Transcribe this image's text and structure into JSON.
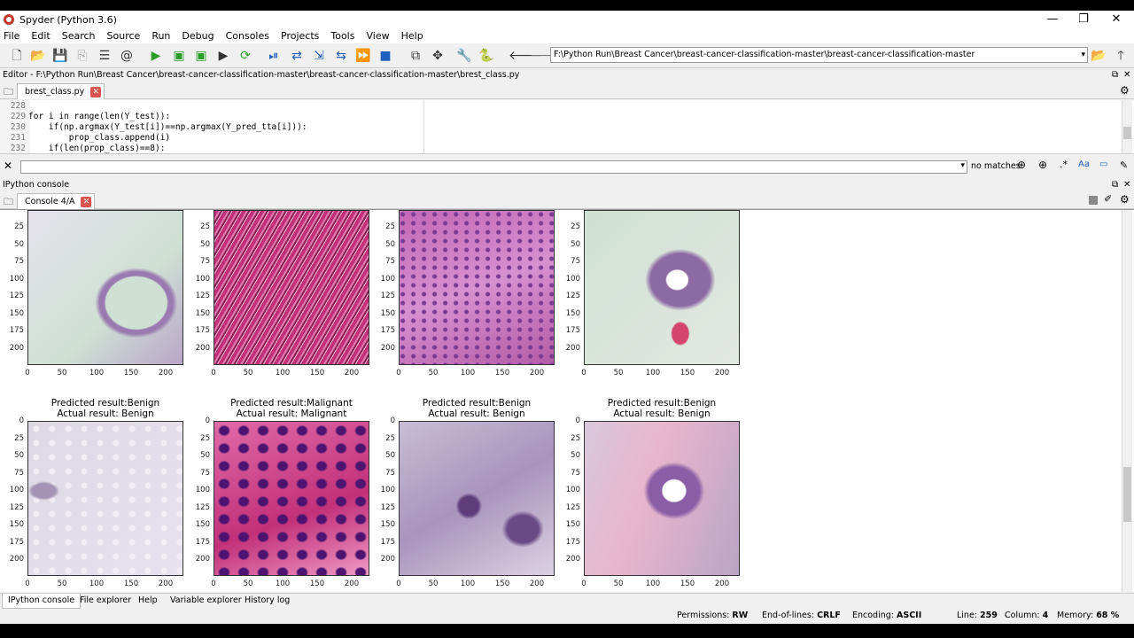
{
  "window": {
    "title": "Spyder (Python 3.6)",
    "minimize": "—",
    "maximize": "❐",
    "close": "✕"
  },
  "menu": [
    "File",
    "Edit",
    "Search",
    "Source",
    "Run",
    "Debug",
    "Consoles",
    "Projects",
    "Tools",
    "View",
    "Help"
  ],
  "toolbar": {
    "path": "F:\\Python Run\\Breast Cancer\\breast-cancer-classification-master\\breast-cancer-classification-master"
  },
  "editor": {
    "header": "Editor - F:\\Python Run\\Breast Cancer\\breast-cancer-classification-master\\breast-cancer-classification-master\\brest_class.py",
    "tab": "brest_class.py",
    "lines": [
      {
        "num": "228",
        "code": ""
      },
      {
        "num": "229",
        "code": "for i in range(len(Y_test)):"
      },
      {
        "num": "230",
        "code": "    if(np.argmax(Y_test[i])==np.argmax(Y_pred_tta[i])):"
      },
      {
        "num": "231",
        "code": "        prop_class.append(i)"
      },
      {
        "num": "232",
        "code": "    if(len(prop_class)==8):"
      }
    ]
  },
  "find": {
    "status": "no matches",
    "value": ""
  },
  "console": {
    "header": "IPython console",
    "tab": "Console 4/A",
    "yticks_top": [
      "25",
      "50",
      "75",
      "100",
      "125",
      "150",
      "175",
      "200"
    ],
    "yticks_bottom": [
      "0",
      "25",
      "50",
      "75",
      "100",
      "125",
      "150",
      "175",
      "200"
    ],
    "xticks": [
      "0",
      "50",
      "100",
      "150",
      "200"
    ],
    "row2_titles": [
      {
        "pred": "Predicted result:Benign",
        "actual": "Actual result: Benign"
      },
      {
        "pred": "Predicted result:Malignant",
        "actual": "Actual result: Malignant"
      },
      {
        "pred": "Predicted result:Benign",
        "actual": "Actual result: Benign"
      },
      {
        "pred": "Predicted result:Benign",
        "actual": "Actual result: Benign"
      }
    ],
    "tissue_colors": {
      "benign_pale": "#dcd8e4",
      "malignant_dense": "#c2307a",
      "pink": "#c468b8",
      "green_stroma": "#cfe0d4"
    }
  },
  "bottom_tabs": [
    "IPython console",
    "File explorer",
    "Help",
    "Variable explorer",
    "History log"
  ],
  "status": {
    "permissions_label": "Permissions:",
    "permissions": "RW",
    "eol_label": "End-of-lines:",
    "eol": "CRLF",
    "encoding_label": "Encoding:",
    "encoding": "ASCII",
    "line_label": "Line:",
    "line": "259",
    "column_label": "Column:",
    "column": "4",
    "memory_label": "Memory:",
    "memory": "68 %"
  }
}
